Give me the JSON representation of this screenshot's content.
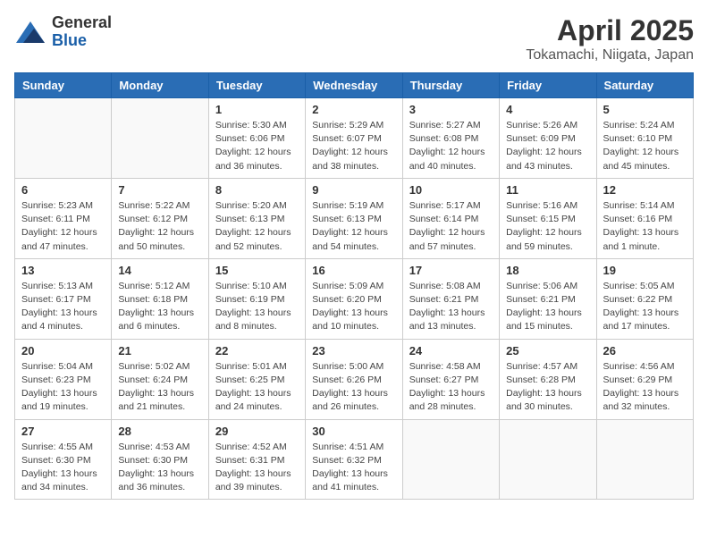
{
  "header": {
    "logo_general": "General",
    "logo_blue": "Blue",
    "month_title": "April 2025",
    "location": "Tokamachi, Niigata, Japan"
  },
  "weekdays": [
    "Sunday",
    "Monday",
    "Tuesday",
    "Wednesday",
    "Thursday",
    "Friday",
    "Saturday"
  ],
  "weeks": [
    [
      {
        "day": "",
        "info": ""
      },
      {
        "day": "",
        "info": ""
      },
      {
        "day": "1",
        "info": "Sunrise: 5:30 AM\nSunset: 6:06 PM\nDaylight: 12 hours\nand 36 minutes."
      },
      {
        "day": "2",
        "info": "Sunrise: 5:29 AM\nSunset: 6:07 PM\nDaylight: 12 hours\nand 38 minutes."
      },
      {
        "day": "3",
        "info": "Sunrise: 5:27 AM\nSunset: 6:08 PM\nDaylight: 12 hours\nand 40 minutes."
      },
      {
        "day": "4",
        "info": "Sunrise: 5:26 AM\nSunset: 6:09 PM\nDaylight: 12 hours\nand 43 minutes."
      },
      {
        "day": "5",
        "info": "Sunrise: 5:24 AM\nSunset: 6:10 PM\nDaylight: 12 hours\nand 45 minutes."
      }
    ],
    [
      {
        "day": "6",
        "info": "Sunrise: 5:23 AM\nSunset: 6:11 PM\nDaylight: 12 hours\nand 47 minutes."
      },
      {
        "day": "7",
        "info": "Sunrise: 5:22 AM\nSunset: 6:12 PM\nDaylight: 12 hours\nand 50 minutes."
      },
      {
        "day": "8",
        "info": "Sunrise: 5:20 AM\nSunset: 6:13 PM\nDaylight: 12 hours\nand 52 minutes."
      },
      {
        "day": "9",
        "info": "Sunrise: 5:19 AM\nSunset: 6:13 PM\nDaylight: 12 hours\nand 54 minutes."
      },
      {
        "day": "10",
        "info": "Sunrise: 5:17 AM\nSunset: 6:14 PM\nDaylight: 12 hours\nand 57 minutes."
      },
      {
        "day": "11",
        "info": "Sunrise: 5:16 AM\nSunset: 6:15 PM\nDaylight: 12 hours\nand 59 minutes."
      },
      {
        "day": "12",
        "info": "Sunrise: 5:14 AM\nSunset: 6:16 PM\nDaylight: 13 hours\nand 1 minute."
      }
    ],
    [
      {
        "day": "13",
        "info": "Sunrise: 5:13 AM\nSunset: 6:17 PM\nDaylight: 13 hours\nand 4 minutes."
      },
      {
        "day": "14",
        "info": "Sunrise: 5:12 AM\nSunset: 6:18 PM\nDaylight: 13 hours\nand 6 minutes."
      },
      {
        "day": "15",
        "info": "Sunrise: 5:10 AM\nSunset: 6:19 PM\nDaylight: 13 hours\nand 8 minutes."
      },
      {
        "day": "16",
        "info": "Sunrise: 5:09 AM\nSunset: 6:20 PM\nDaylight: 13 hours\nand 10 minutes."
      },
      {
        "day": "17",
        "info": "Sunrise: 5:08 AM\nSunset: 6:21 PM\nDaylight: 13 hours\nand 13 minutes."
      },
      {
        "day": "18",
        "info": "Sunrise: 5:06 AM\nSunset: 6:21 PM\nDaylight: 13 hours\nand 15 minutes."
      },
      {
        "day": "19",
        "info": "Sunrise: 5:05 AM\nSunset: 6:22 PM\nDaylight: 13 hours\nand 17 minutes."
      }
    ],
    [
      {
        "day": "20",
        "info": "Sunrise: 5:04 AM\nSunset: 6:23 PM\nDaylight: 13 hours\nand 19 minutes."
      },
      {
        "day": "21",
        "info": "Sunrise: 5:02 AM\nSunset: 6:24 PM\nDaylight: 13 hours\nand 21 minutes."
      },
      {
        "day": "22",
        "info": "Sunrise: 5:01 AM\nSunset: 6:25 PM\nDaylight: 13 hours\nand 24 minutes."
      },
      {
        "day": "23",
        "info": "Sunrise: 5:00 AM\nSunset: 6:26 PM\nDaylight: 13 hours\nand 26 minutes."
      },
      {
        "day": "24",
        "info": "Sunrise: 4:58 AM\nSunset: 6:27 PM\nDaylight: 13 hours\nand 28 minutes."
      },
      {
        "day": "25",
        "info": "Sunrise: 4:57 AM\nSunset: 6:28 PM\nDaylight: 13 hours\nand 30 minutes."
      },
      {
        "day": "26",
        "info": "Sunrise: 4:56 AM\nSunset: 6:29 PM\nDaylight: 13 hours\nand 32 minutes."
      }
    ],
    [
      {
        "day": "27",
        "info": "Sunrise: 4:55 AM\nSunset: 6:30 PM\nDaylight: 13 hours\nand 34 minutes."
      },
      {
        "day": "28",
        "info": "Sunrise: 4:53 AM\nSunset: 6:30 PM\nDaylight: 13 hours\nand 36 minutes."
      },
      {
        "day": "29",
        "info": "Sunrise: 4:52 AM\nSunset: 6:31 PM\nDaylight: 13 hours\nand 39 minutes."
      },
      {
        "day": "30",
        "info": "Sunrise: 4:51 AM\nSunset: 6:32 PM\nDaylight: 13 hours\nand 41 minutes."
      },
      {
        "day": "",
        "info": ""
      },
      {
        "day": "",
        "info": ""
      },
      {
        "day": "",
        "info": ""
      }
    ]
  ]
}
